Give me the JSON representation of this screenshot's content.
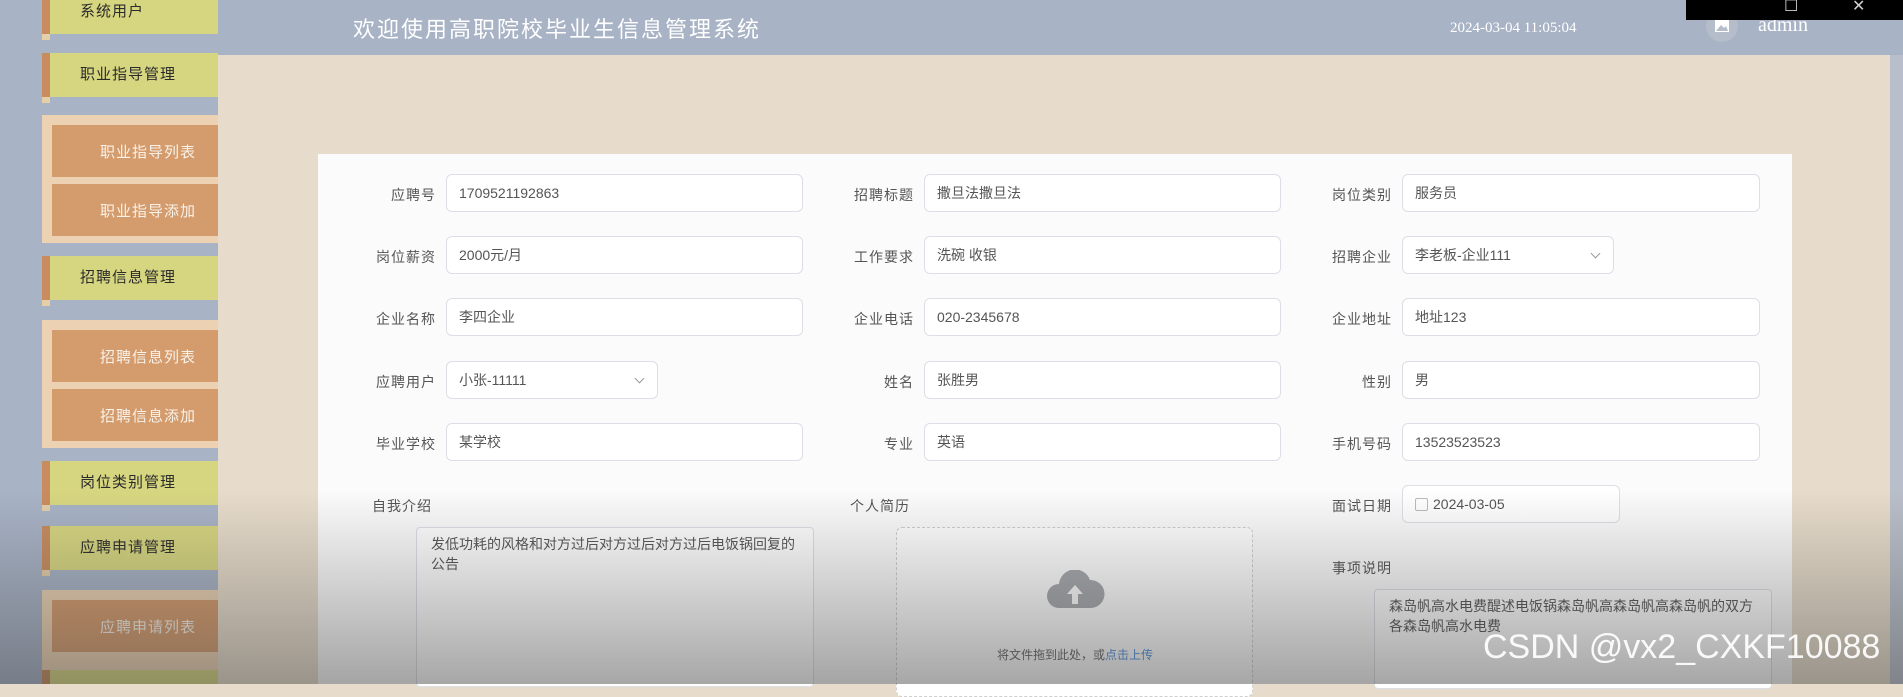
{
  "sidebar": {
    "items": [
      {
        "label": "系统用户"
      },
      {
        "label": "职业指导管理"
      },
      {
        "label": "职业指导列表"
      },
      {
        "label": "职业指导添加"
      },
      {
        "label": "招聘信息管理"
      },
      {
        "label": "招聘信息列表"
      },
      {
        "label": "招聘信息添加"
      },
      {
        "label": "岗位类别管理"
      },
      {
        "label": "应聘申请管理"
      },
      {
        "label": "应聘申请列表"
      }
    ]
  },
  "header": {
    "title": "欢迎使用高职院校毕业生信息管理系统",
    "datetime": "2024-03-04 11:05:04",
    "user": "admin"
  },
  "window": {
    "maximize": "☐",
    "close": "✕"
  },
  "form": {
    "application_no": {
      "label": "应聘号",
      "value": "1709521192863"
    },
    "recruit_title": {
      "label": "招聘标题",
      "value": "撒旦法撒旦法"
    },
    "position_type": {
      "label": "岗位类别",
      "value": "服务员"
    },
    "salary": {
      "label": "岗位薪资",
      "value": "2000元/月"
    },
    "requirements": {
      "label": "工作要求",
      "value": "洗碗 收银"
    },
    "recruit_company": {
      "label": "招聘企业",
      "value": "李老板-企业111"
    },
    "company_name": {
      "label": "企业名称",
      "value": "李四企业"
    },
    "company_phone": {
      "label": "企业电话",
      "value": "020-2345678"
    },
    "company_address": {
      "label": "企业地址",
      "value": "地址123"
    },
    "applicant_user": {
      "label": "应聘用户",
      "value": "小张-11111"
    },
    "name": {
      "label": "姓名",
      "value": "张胜男"
    },
    "gender": {
      "label": "性别",
      "value": "男"
    },
    "school": {
      "label": "毕业学校",
      "value": "某学校"
    },
    "major": {
      "label": "专业",
      "value": "英语"
    },
    "mobile": {
      "label": "手机号码",
      "value": "13523523523"
    },
    "self_intro": {
      "label": "自我介绍",
      "value": "发低功耗的风格和对方过后对方过后对方过后电饭锅回复的公告"
    },
    "resume": {
      "label": "个人简历",
      "upload_text": "将文件拖到此处，或",
      "upload_link": "点击上传"
    },
    "interview_date": {
      "label": "面试日期",
      "value": "2024-03-05"
    },
    "notes": {
      "label": "事项说明",
      "value": "森岛帆高水电费醍述电饭锅森岛帆高森岛帆高森岛帆的双方各森岛帆高水电费"
    }
  },
  "watermark": "CSDN @vx2_CXKF10088"
}
